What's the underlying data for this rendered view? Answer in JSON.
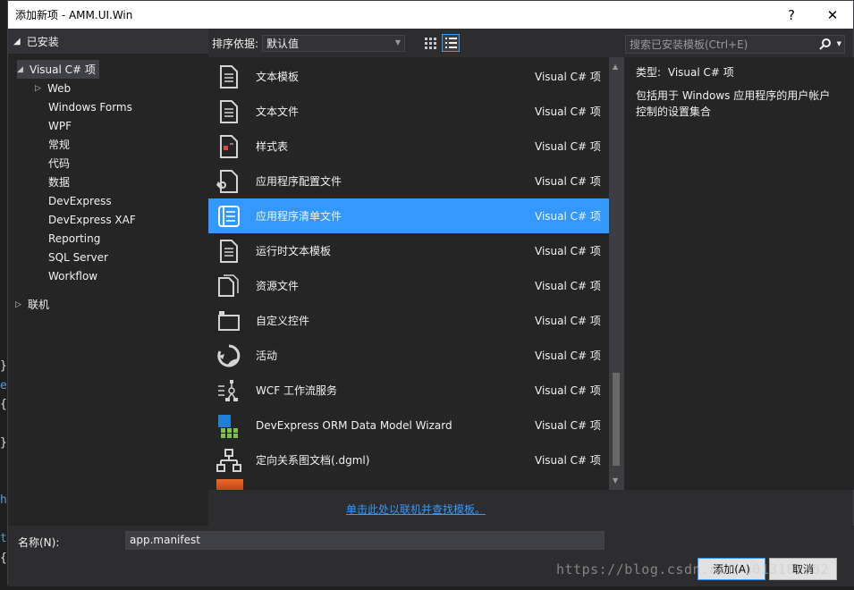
{
  "background": {
    "code_glyphs": [
      "}",
      "e",
      "{",
      "}",
      "h",
      "t",
      "{"
    ]
  },
  "titlebar": {
    "title": "添加新项 - AMM.UI.Win",
    "help": "?",
    "close": "✕"
  },
  "left_panel": {
    "header": "已安装",
    "tree": [
      {
        "label": "Visual C# 项",
        "expander": "◢",
        "selected": true
      },
      {
        "label": "Web",
        "expander": "▷"
      },
      {
        "label": "Windows Forms"
      },
      {
        "label": "WPF"
      },
      {
        "label": "常规"
      },
      {
        "label": "代码"
      },
      {
        "label": "数据"
      },
      {
        "label": "DevExpress"
      },
      {
        "label": "DevExpress XAF"
      },
      {
        "label": "Reporting"
      },
      {
        "label": "SQL Server"
      },
      {
        "label": "Workflow"
      },
      {
        "label": "联机",
        "expander": "▷"
      }
    ]
  },
  "toolbar": {
    "sort_label": "排序依据:",
    "sort_value": "默认值",
    "search_placeholder": "搜索已安装模板(Ctrl+E)"
  },
  "templates": [
    {
      "name": "文本模板",
      "type": "Visual C# 项",
      "icon": "text-template-icon"
    },
    {
      "name": "文本文件",
      "type": "Visual C# 项",
      "icon": "text-file-icon"
    },
    {
      "name": "样式表",
      "type": "Visual C# 项",
      "icon": "stylesheet-icon"
    },
    {
      "name": "应用程序配置文件",
      "type": "Visual C# 项",
      "icon": "config-file-icon"
    },
    {
      "name": "应用程序清单文件",
      "type": "Visual C# 项",
      "icon": "manifest-file-icon",
      "selected": true
    },
    {
      "name": "运行时文本模板",
      "type": "Visual C# 项",
      "icon": "runtime-text-template-icon"
    },
    {
      "name": "资源文件",
      "type": "Visual C# 项",
      "icon": "resource-file-icon"
    },
    {
      "name": "自定义控件",
      "type": "Visual C# 项",
      "icon": "custom-control-icon"
    },
    {
      "name": "活动",
      "type": "Visual C# 项",
      "icon": "activity-icon"
    },
    {
      "name": "WCF 工作流服务",
      "type": "Visual C# 项",
      "icon": "wcf-workflow-icon"
    },
    {
      "name": "DevExpress ORM Data Model Wizard",
      "type": "Visual C# 项",
      "icon": "devexpress-orm-icon"
    },
    {
      "name": "定向关系图文档(.dgml)",
      "type": "Visual C# 项",
      "icon": "dgml-icon"
    }
  ],
  "info_panel": {
    "type_label": "类型:",
    "type_value": "Visual C# 项",
    "description": "包括用于 Windows 应用程序的用户帐户控制的设置集合"
  },
  "online_link": "单击此处以联机并查找模板。",
  "name_field": {
    "label": "名称(N):",
    "value": "app.manifest"
  },
  "buttons": {
    "add": "添加(A)",
    "cancel": "取消"
  },
  "watermark": "https://blog.csdn.net/u013187382",
  "colors": {
    "accent": "#3399ff",
    "panel": "#252526",
    "dialog": "#2d2d30"
  }
}
